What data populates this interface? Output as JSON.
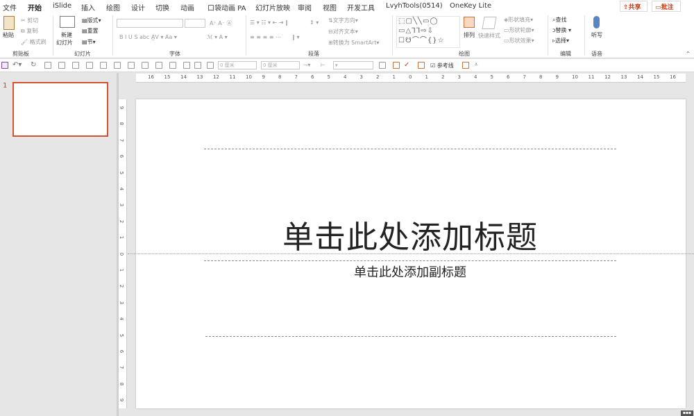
{
  "tabs": [
    "文件",
    "开始",
    "iSlide",
    "插入",
    "绘图",
    "设计",
    "切换",
    "动画",
    "口袋动画 PA",
    "幻灯片放映",
    "审阅",
    "视图",
    "开发工具",
    "LvyhTools(0514)",
    "OneKey Lite"
  ],
  "share": {
    "share_label": "共享",
    "comment_label": "批注"
  },
  "clipboard": {
    "paste": "粘贴",
    "cut": "剪切",
    "copy": "复制",
    "format_painter": "格式刷",
    "group": "剪贴板"
  },
  "slides": {
    "new_slide_l1": "新建",
    "new_slide_l2": "幻灯片",
    "layout": "版式",
    "reset": "重置",
    "section": "节",
    "group": "幻灯片"
  },
  "font": {
    "group": "字体"
  },
  "paragraph": {
    "text_direction": "文字方向",
    "align_text": "对齐文本",
    "smartart": "转换为 SmartArt",
    "group": "段落"
  },
  "drawing": {
    "arrange": "排列",
    "quick_styles": "快速样式",
    "shape_fill": "形状填充",
    "shape_outline": "形状轮廓",
    "shape_effects": "形状效果",
    "group": "绘图"
  },
  "editing": {
    "find": "查找",
    "replace": "替换",
    "select": "选择",
    "group": "编辑"
  },
  "voice": {
    "dictate": "听写",
    "group": "语音"
  },
  "qat": {
    "width_value": "0 厘米",
    "height_value": "0 厘米",
    "guides_label": "参考线"
  },
  "thumb": {
    "number": "1"
  },
  "slide": {
    "title_placeholder": "单击此处添加标题",
    "subtitle_placeholder": "单击此处添加副标题"
  },
  "ruler": {
    "h_labels": [
      "16",
      "15",
      "14",
      "13",
      "12",
      "11",
      "10",
      "9",
      "8",
      "7",
      "6",
      "5",
      "4",
      "3",
      "2",
      "1",
      "0",
      "1",
      "2",
      "3",
      "4",
      "5",
      "6",
      "7",
      "8",
      "9",
      "10",
      "11",
      "12",
      "13",
      "14",
      "15",
      "16"
    ],
    "v_labels": [
      "9",
      "8",
      "7",
      "6",
      "5",
      "4",
      "3",
      "2",
      "1",
      "0",
      "1",
      "2",
      "3",
      "4",
      "5",
      "6",
      "7",
      "8",
      "9"
    ]
  },
  "colors": {
    "accent": "#c43e1c"
  }
}
